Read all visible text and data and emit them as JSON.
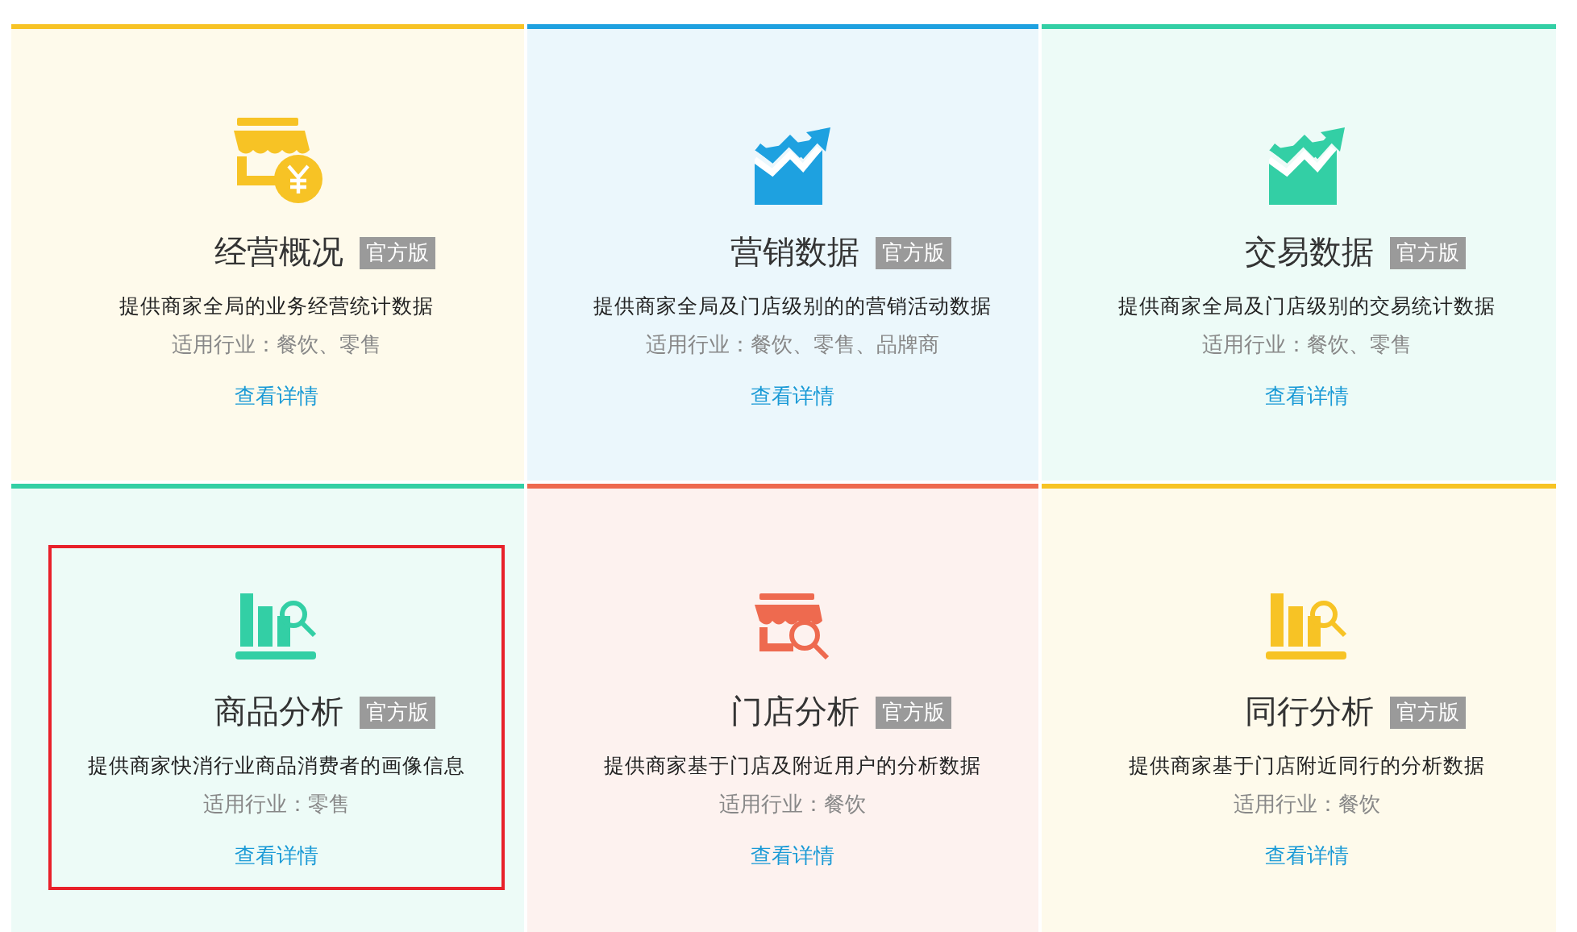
{
  "cards": [
    {
      "kind": "store-yen",
      "color": "#f7c325",
      "title": "经营概况",
      "badge": "官方版",
      "description": "提供商家全局的业务经营统计数据",
      "industries": "适用行业：餐饮、零售",
      "link": "查看详情",
      "highlighted": false
    },
    {
      "kind": "trend",
      "color": "#1ea1e0",
      "title": "营销数据",
      "badge": "官方版",
      "description": "提供商家全局及门店级别的的营销活动数据",
      "industries": "适用行业：餐饮、零售、品牌商",
      "link": "查看详情",
      "highlighted": false
    },
    {
      "kind": "trend",
      "color": "#33cfa5",
      "title": "交易数据",
      "badge": "官方版",
      "description": "提供商家全局及门店级别的交易统计数据",
      "industries": "适用行业：餐饮、零售",
      "link": "查看详情",
      "highlighted": false
    },
    {
      "kind": "bars-search",
      "color": "#33cfa5",
      "title": "商品分析",
      "badge": "官方版",
      "description": "提供商家快消行业商品消费者的画像信息",
      "industries": "适用行业：零售",
      "link": "查看详情",
      "highlighted": true
    },
    {
      "kind": "store-search",
      "color": "#ee6a4f",
      "title": "门店分析",
      "badge": "官方版",
      "description": "提供商家基于门店及附近用户的分析数据",
      "industries": "适用行业：餐饮",
      "link": "查看详情",
      "highlighted": false
    },
    {
      "kind": "bars-search",
      "color": "#f7c325",
      "title": "同行分析",
      "badge": "官方版",
      "description": "提供商家基于门店附近同行的分析数据",
      "industries": "适用行业：餐饮",
      "link": "查看详情",
      "highlighted": false
    }
  ]
}
